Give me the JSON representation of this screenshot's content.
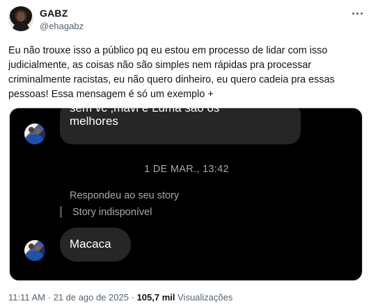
{
  "author": {
    "name": "GABZ",
    "handle": "@ehagabz"
  },
  "tweet": {
    "text": "Eu não trouxe isso a público pq eu estou em processo de lidar com isso judicialmente, as coisas não são simples nem rápidas pra processar criminalmente racistas, eu não quero dinheiro, eu quero cadeia pra essas pessoas! Essa mensagem é só um exemplo +"
  },
  "media": {
    "top_bubble_line1": "sem vc ,mavi e Luma são os",
    "top_bubble_line2": "melhores",
    "date": "1 DE MAR., 13:42",
    "replied_label": "Respondeu ao seu story",
    "story_label": "Story indisponível",
    "message": "Macaca"
  },
  "meta": {
    "time": "11:11 AM",
    "separator1": " · ",
    "date": "21 de ago de 2025",
    "separator2": " · ",
    "views_count": "105,7 mil",
    "views_label": "Visualizações"
  },
  "icons": {
    "more": "more-horizontal-icon"
  }
}
